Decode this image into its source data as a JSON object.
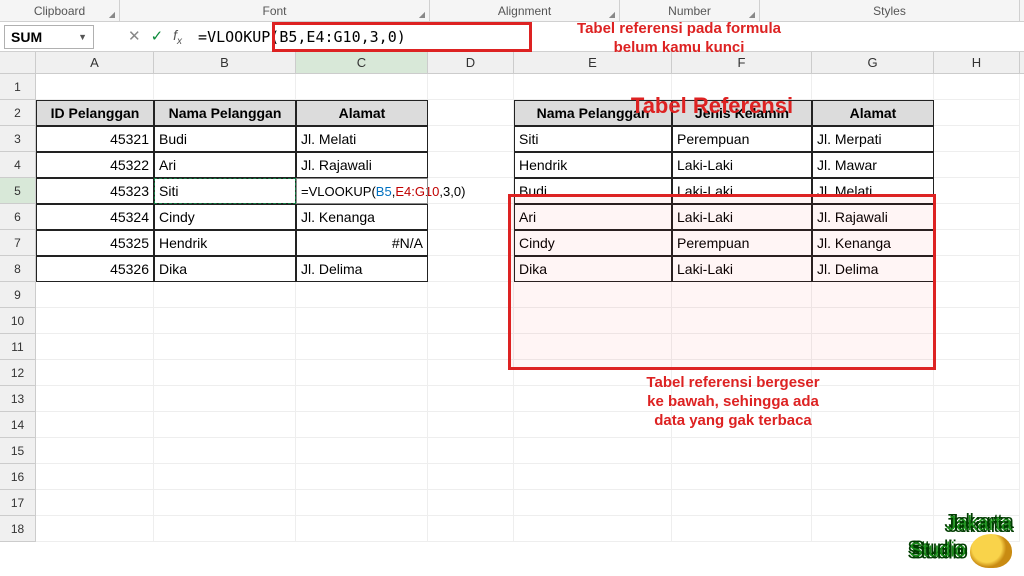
{
  "ribbon_groups": {
    "clipboard": "Clipboard",
    "font": "Font",
    "alignment": "Alignment",
    "number": "Number",
    "styles": "Styles"
  },
  "name_box": "SUM",
  "formula_bar": "=VLOOKUP(B5,E4:G10,3,0)",
  "columns": [
    "A",
    "B",
    "C",
    "D",
    "E",
    "F",
    "G",
    "H"
  ],
  "rows": [
    "1",
    "2",
    "3",
    "4",
    "5",
    "6",
    "7",
    "8",
    "9",
    "10",
    "11",
    "12",
    "13",
    "14",
    "15",
    "16",
    "17",
    "18"
  ],
  "left_table": {
    "headers": [
      "ID Pelanggan",
      "Nama Pelanggan",
      "Alamat"
    ],
    "rows": [
      {
        "id": "45321",
        "nama": "Budi",
        "alamat": "Jl. Melati"
      },
      {
        "id": "45322",
        "nama": "Ari",
        "alamat": "Jl. Rajawali"
      },
      {
        "id": "45323",
        "nama": "Siti",
        "alamat": "=VLOOKUP(B5,E4:G10,3,0)",
        "editing": true
      },
      {
        "id": "45324",
        "nama": "Cindy",
        "alamat": "Jl. Kenanga"
      },
      {
        "id": "45325",
        "nama": "Hendrik",
        "alamat": "#N/A",
        "na": true
      },
      {
        "id": "45326",
        "nama": "Dika",
        "alamat": "Jl. Delima"
      }
    ]
  },
  "ref_table": {
    "headers": [
      "Nama Pelanggan",
      "Jenis Kelamin",
      "Alamat"
    ],
    "rows": [
      {
        "nama": "Siti",
        "jk": "Perempuan",
        "alamat": "Jl. Merpati"
      },
      {
        "nama": "Hendrik",
        "jk": "Laki-Laki",
        "alamat": "Jl. Mawar"
      },
      {
        "nama": "Budi",
        "jk": "Laki-Laki",
        "alamat": "Jl. Melati"
      },
      {
        "nama": "Ari",
        "jk": "Laki-Laki",
        "alamat": "Jl. Rajawali"
      },
      {
        "nama": "Cindy",
        "jk": "Perempuan",
        "alamat": "Jl. Kenanga"
      },
      {
        "nama": "Dika",
        "jk": "Laki-Laki",
        "alamat": "Jl. Delima"
      }
    ]
  },
  "cell_formula": {
    "prefix": "=VLOOKUP(",
    "arg1": "B5",
    "c1": ",",
    "arg2": "E4:G10",
    "suffix": ",3,0)"
  },
  "annotations": {
    "formula_note": "Tabel referensi pada formula\nbelum kamu kunci",
    "ref_title": "Tabel Referensi",
    "shift_note": "Tabel referensi bergeser\nke bawah, sehingga ada\ndata yang gak terbaca"
  },
  "logo": {
    "line1": "Jakarta",
    "line2": "Studio"
  }
}
